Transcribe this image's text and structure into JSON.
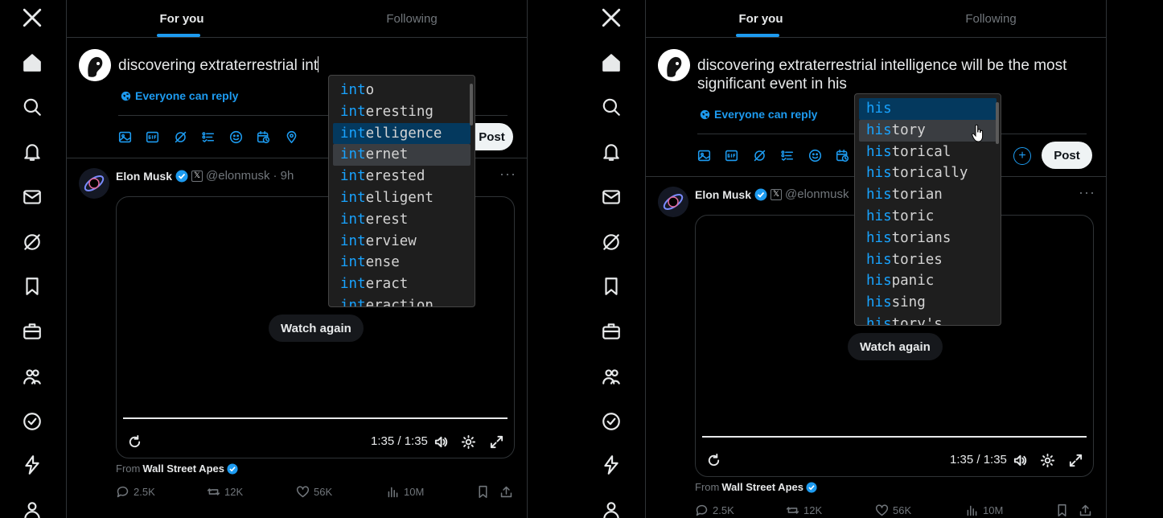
{
  "colors": {
    "accent": "#1d9bf0",
    "bg": "#000000",
    "border": "#2f3336",
    "text": "#e7e9ea",
    "muted": "#71767b",
    "autocomplete_match": "#18a3ff",
    "autocomplete_selected": "#04395e"
  },
  "nav_icons": [
    "x-logo-icon",
    "home-icon",
    "search-icon",
    "notifications-icon",
    "messages-icon",
    "grok-icon",
    "bookmarks-icon",
    "jobs-icon",
    "communities-icon",
    "premium-icon",
    "verified-orgs-icon",
    "profile-icon"
  ],
  "tabs": {
    "for_you": "For you",
    "following": "Following"
  },
  "compose": {
    "left_text": "discovering extraterrestrial int",
    "right_text": "discovering extraterrestrial intelligence will be the most significant event in his",
    "reply_setting": "Everyone can reply",
    "post_label": "Post"
  },
  "tweet": {
    "name": "Elon Musk",
    "handle": "@elonmusk",
    "time": "· 9h",
    "watch_again": "Watch again",
    "time_display": "1:35 / 1:35",
    "from_prefix": "From",
    "from_source": "Wall Street Apes",
    "replies": "2.5K",
    "reposts": "12K",
    "likes": "56K",
    "views": "10M"
  },
  "autocomplete_left": {
    "prefix": "int",
    "items": [
      {
        "rest": "o"
      },
      {
        "rest": "eresting"
      },
      {
        "rest": "elligence"
      },
      {
        "rest": "ernet"
      },
      {
        "rest": "erested"
      },
      {
        "rest": "elligent"
      },
      {
        "rest": "erest"
      },
      {
        "rest": "erview"
      },
      {
        "rest": "ense"
      },
      {
        "rest": "eract"
      },
      {
        "rest": "eraction"
      }
    ],
    "selected": 2,
    "hover": 3
  },
  "autocomplete_right": {
    "prefix": "his",
    "items": [
      {
        "rest": ""
      },
      {
        "rest": "tory"
      },
      {
        "rest": "torical"
      },
      {
        "rest": "torically"
      },
      {
        "rest": "torian"
      },
      {
        "rest": "toric"
      },
      {
        "rest": "torians"
      },
      {
        "rest": "tories"
      },
      {
        "rest": "panic"
      },
      {
        "rest": "sing"
      },
      {
        "rest": "tory's"
      }
    ],
    "selected": 0,
    "hover": 1
  }
}
